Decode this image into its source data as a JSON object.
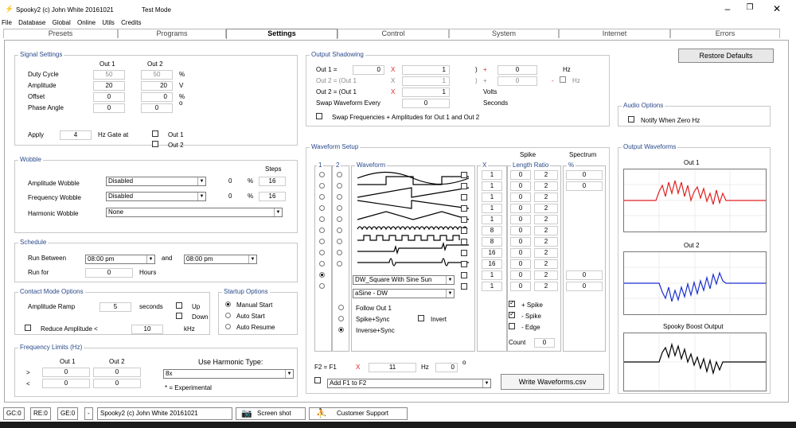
{
  "window": {
    "title": "Spooky2 (c) John White 20161021",
    "mode": "Test Mode",
    "minimize": "–",
    "maximize": "❐",
    "close": "✕"
  },
  "menu": [
    "File",
    "Database",
    "Global",
    "Online",
    "Utils",
    "Credits"
  ],
  "tabs": [
    "Presets",
    "Programs",
    "Settings",
    "Control",
    "System",
    "Internet",
    "Errors"
  ],
  "signal": {
    "title": "Signal Settings",
    "col1": "Out 1",
    "col2": "Out 2",
    "rows": [
      {
        "label": "Duty Cycle",
        "v1": "50",
        "v2": "50",
        "unit": "%"
      },
      {
        "label": "Amplitude",
        "v1": "20",
        "v2": "20",
        "unit": "V"
      },
      {
        "label": "Offset",
        "v1": "0",
        "v2": "0",
        "unit": "%"
      },
      {
        "label": "Phase Angle",
        "v1": "0",
        "v2": "0",
        "unit": "o"
      }
    ],
    "apply_label": "Apply",
    "apply_value": "4",
    "gate_label": "Hz Gate at",
    "out1": "Out 1",
    "out2": "Out 2"
  },
  "wobble": {
    "title": "Wobble",
    "steps_label": "Steps",
    "amp_label": "Amplitude Wobble",
    "amp_sel": "Disabled",
    "amp_val": "0",
    "amp_unit": "%",
    "amp_steps": "16",
    "freq_label": "Frequency Wobble",
    "freq_sel": "Disabled",
    "freq_val": "0",
    "freq_unit": "%",
    "freq_steps": "16",
    "harm_label": "Harmonic Wobble",
    "harm_sel": "None"
  },
  "schedule": {
    "title": "Schedule",
    "between_label": "Run Between",
    "from": "08:00 pm",
    "and": "and",
    "to": "08:00 pm",
    "for_label": "Run for",
    "for_val": "0",
    "hours": "Hours"
  },
  "contact": {
    "title": "Contact Mode Options",
    "ramp_label": "Amplitude Ramp",
    "ramp_val": "5",
    "seconds": "seconds",
    "up": "Up",
    "down": "Down",
    "reduce_label": "Reduce Amplitude <",
    "reduce_val": "10",
    "khz": "kHz"
  },
  "startup": {
    "title": "Startup Options",
    "opts": [
      "Manual Start",
      "Auto Start",
      "Auto Resume"
    ]
  },
  "freq_limits": {
    "title": "Frequency Limits (Hz)",
    "out1": "Out 1",
    "out2": "Out 2",
    "gt": ">",
    "lt": "<",
    "gt1": "0",
    "gt2": "0",
    "lt1": "0",
    "lt2": "0",
    "harm_label": "Use Harmonic Type:",
    "harm_sel": "8x",
    "note": "* = Experimental"
  },
  "shadow": {
    "title": "Output Shadowing",
    "r1": {
      "label": "Out 1 =",
      "a": "0",
      "x": "X",
      "b": "1",
      "p": ")",
      "plus": "+",
      "c": "0",
      "unit": "Hz"
    },
    "r2": {
      "label": "Out 2 = (Out 1",
      "x": "X",
      "b": "1",
      "p": ")",
      "plus": "+",
      "c": "0",
      "minus": "-",
      "unit": "Hz"
    },
    "r3": {
      "label": "Out 2 = (Out 1",
      "x": "X",
      "b": "1",
      "unit": "Volts"
    },
    "swap_label": "Swap Waveform Every",
    "swap_val": "0",
    "swap_unit": "Seconds",
    "swap_freq": "Swap Frequencies + Amplitudes for Out 1 and Out 2"
  },
  "restore": "Restore Defaults",
  "audio": {
    "title": "Audio Options",
    "notify": "Notify When Zero Hz"
  },
  "waveform": {
    "title": "Waveform Setup",
    "col1": "1",
    "col2": "2",
    "wf_label": "Waveform",
    "x_label": "X",
    "spike_label": "Spike",
    "len_label": "Length Ratio",
    "spectrum_label": "Spectrum",
    "pct": "%",
    "x_vals": [
      "1",
      "1",
      "1",
      "1",
      "1",
      "8",
      "8",
      "16",
      "16",
      "1",
      "1"
    ],
    "len_vals": [
      "0",
      "0",
      "0",
      "0",
      "0",
      "0",
      "0",
      "0",
      "0",
      "0",
      "0"
    ],
    "ratio_vals": [
      "2",
      "2",
      "2",
      "2",
      "2",
      "2",
      "2",
      "2",
      "2",
      "2",
      "2"
    ],
    "spec_vals": [
      "0",
      "0",
      "",
      "",
      "",
      "",
      "",
      "",
      "",
      "0",
      "0"
    ],
    "sel1": "DW_Square With Sine Sun",
    "sel2": "aSine - DW",
    "follow": "Follow Out 1",
    "spike_sync": "Spike+Sync",
    "invert": "Invert",
    "inverse_sync": "Inverse+Sync",
    "plus_spike": "+ Spike",
    "minus_spike": "- Spike",
    "edge": "- Edge",
    "count_label": "Count",
    "count_val": "0",
    "f2_label": "F2 = F1",
    "f2_x": "X",
    "f2_val": "11",
    "f2_hz": "Hz",
    "f2_deg": "0",
    "f2_o": "o",
    "add_sel": "Add F1 to F2",
    "write_btn": "Write Waveforms.csv"
  },
  "outwave": {
    "title": "Output Waveforms",
    "o1": "Out 1",
    "o2": "Out 2",
    "boost": "Spooky Boost Output",
    "c1": "#e02020",
    "c2": "#1a2fcf",
    "c3": "#000000"
  },
  "status": {
    "gc": "GC:0",
    "re": "RE:0",
    "ge": "GE:0",
    "dash": "-",
    "name": "Spooky2 (c) John White 20161021",
    "screenshot": "Screen shot",
    "support": "Customer Support"
  }
}
